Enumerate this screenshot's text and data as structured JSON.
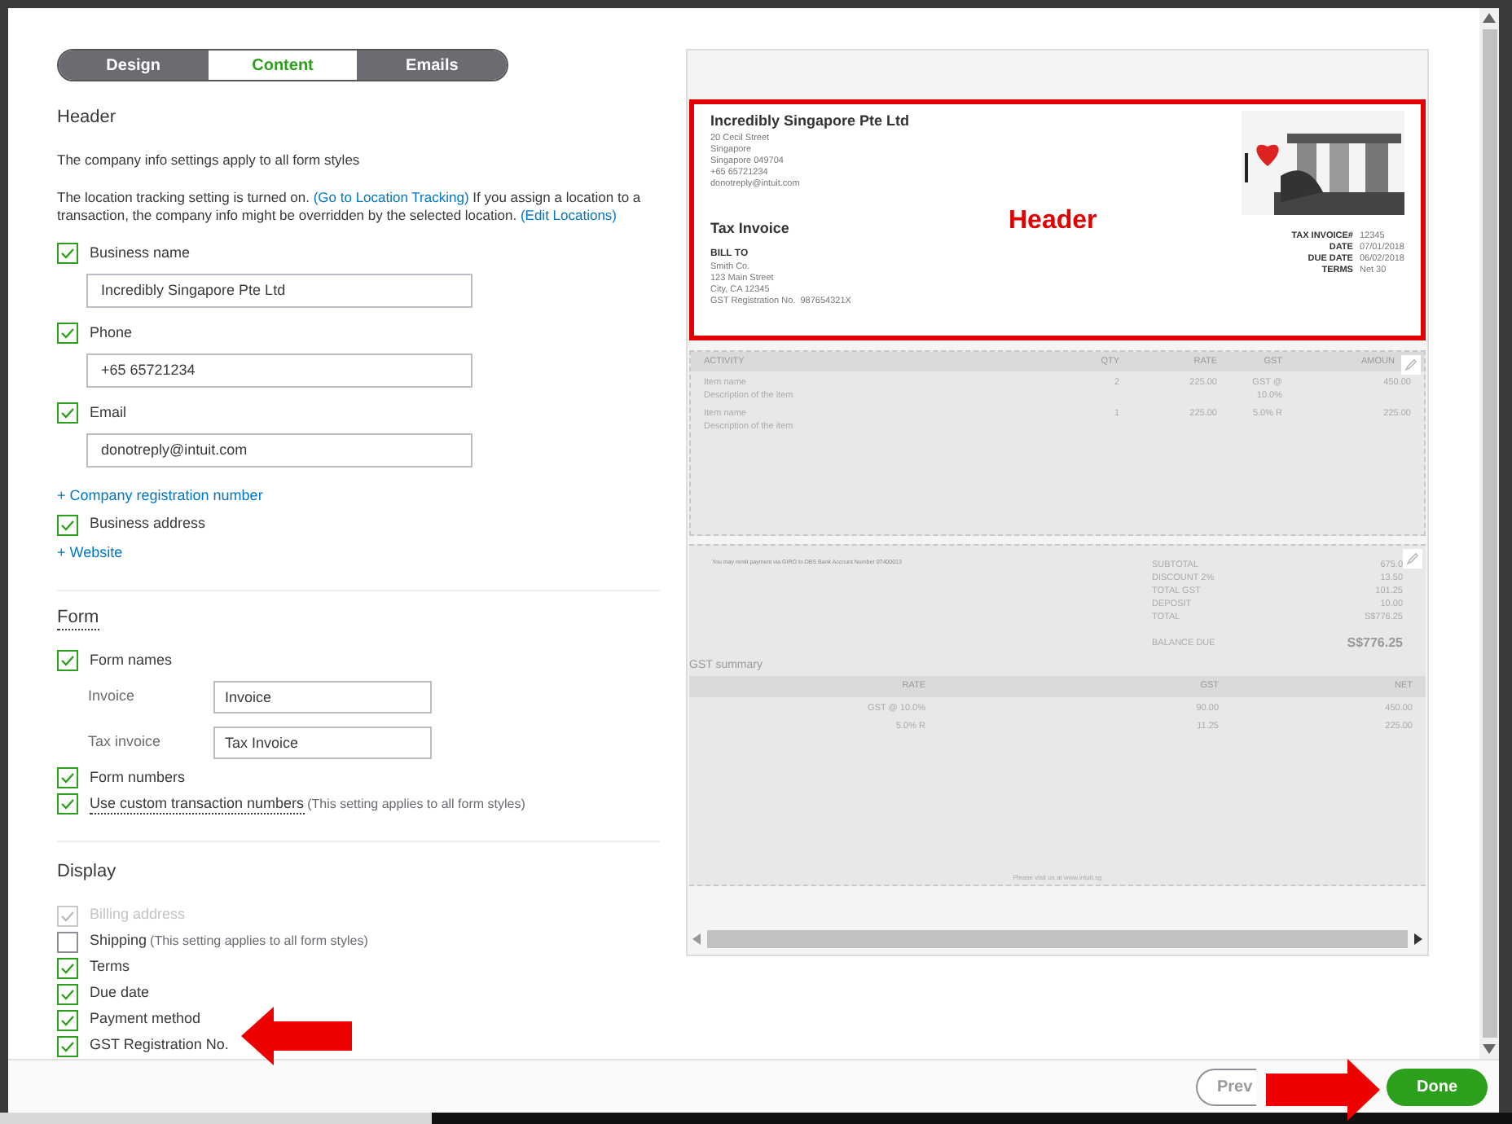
{
  "tabs": [
    {
      "label": "Design",
      "selected": false
    },
    {
      "label": "Content",
      "selected": true
    },
    {
      "label": "Emails",
      "selected": false
    }
  ],
  "sections": [
    {
      "title": "Header",
      "underlined": false,
      "rows": [
        {
          "kind": "text",
          "text": "The company info settings apply to all form styles"
        },
        {
          "kind": "link_text",
          "parts": [
            {
              "text": "The location tracking setting is turned on. ",
              "link": false
            },
            {
              "text": "(Go to Location Tracking)",
              "link": true
            },
            {
              "text": " If you assign a location to a transaction, the company info might be overridden by the selected location. ",
              "link": false
            },
            {
              "text": "(Edit Locations)",
              "link": true
            }
          ]
        },
        {
          "kind": "checkbox_field",
          "label": "Business name",
          "checked": true,
          "value": "Incredibly Singapore Pte Ltd"
        },
        {
          "kind": "checkbox_field",
          "label": "Phone",
          "checked": true,
          "value": "+65 65721234"
        },
        {
          "kind": "checkbox_field",
          "label": "Email",
          "checked": true,
          "value": "donotreply@intuit.com"
        },
        {
          "kind": "link",
          "label": "+ Company registration number"
        },
        {
          "kind": "checkbox",
          "label": "Business address",
          "checked": true
        },
        {
          "kind": "link",
          "label": "+ Website"
        }
      ]
    },
    {
      "title": "Form",
      "underlined": true,
      "rows": [
        {
          "kind": "checkbox",
          "label": "Form names",
          "checked": true
        },
        {
          "kind": "labeled_field",
          "label": "Invoice",
          "value": "Invoice"
        },
        {
          "kind": "labeled_field",
          "label": "Tax invoice",
          "value": "Tax Invoice"
        },
        {
          "kind": "checkbox",
          "label": "Form numbers",
          "checked": true
        },
        {
          "kind": "checkbox",
          "label": "Use custom transaction numbers",
          "note": "(This setting applies to all form styles)",
          "checked": true
        }
      ]
    },
    {
      "title": "Display",
      "underlined": false,
      "rows": [
        {
          "kind": "checkbox",
          "label": "Billing address",
          "checked": true,
          "disabled": true
        },
        {
          "kind": "checkbox",
          "label": "Shipping",
          "note": "(This setting applies to all form styles)",
          "checked": false,
          "disabled": false
        },
        {
          "kind": "checkbox",
          "label": "Terms",
          "checked": true,
          "disabled": false
        },
        {
          "kind": "checkbox",
          "label": "Due date",
          "checked": true,
          "disabled": false
        },
        {
          "kind": "checkbox",
          "label": "Payment method",
          "checked": true,
          "disabled": false
        },
        {
          "kind": "checkbox",
          "label": "GST Registration No.",
          "checked": true,
          "disabled": false
        }
      ]
    }
  ],
  "preview": {
    "company": "Incredibly Singapore Pte Ltd",
    "address": [
      "20 Cecil Street",
      "Singapore",
      "Singapore 049704",
      "+65 65721234",
      "donotreply@intuit.com"
    ],
    "logo": {
      "kind": "picture"
    },
    "doc_title": "Tax Invoice",
    "bill_to_label": "BILL TO",
    "bill_to": [
      "Smith Co.",
      "123 Main Street",
      "City, CA 12345",
      "GST Registration No.  987654321X"
    ],
    "meta": [
      {
        "label": "TAX INVOICE#",
        "value": "12345"
      },
      {
        "label": "DATE",
        "value": "07/01/2018"
      },
      {
        "label": "DUE DATE",
        "value": "06/02/2018"
      },
      {
        "label": "TERMS",
        "value": "Net 30"
      }
    ],
    "columns": [
      "ACTIVITY",
      "QTY",
      "RATE",
      "GST",
      "AMOUN"
    ],
    "items": [
      {
        "name": "Item name",
        "description": "Description of the item",
        "qty": "2",
        "rate": "225.00",
        "gst": "GST @ 10.0%",
        "amount": "450.00"
      },
      {
        "name": "Item name",
        "description": "Description of the item",
        "qty": "1",
        "rate": "225.00",
        "gst": "5.0% R",
        "amount": "225.00"
      }
    ],
    "message": "You may remit payment via GIRO to DBS Bank Account Number 07400013",
    "totals": [
      {
        "label": "SUBTOTAL",
        "value": "675.0"
      },
      {
        "label": "DISCOUNT 2%",
        "value": "13.50"
      },
      {
        "label": "TOTAL GST",
        "value": "101.25"
      },
      {
        "label": "DEPOSIT",
        "value": "10.00"
      },
      {
        "label": "TOTAL",
        "value": "S$776.25"
      }
    ],
    "balance_label": "BALANCE DUE",
    "balance": "S$776.25",
    "gst_title": "GST summary",
    "gst_columns": [
      "RATE",
      "GST",
      "NET"
    ],
    "gst_rows": [
      [
        "GST @ 10.0%",
        "90.00",
        "450.00"
      ],
      [
        "5.0% R",
        "11.25",
        "225.00"
      ]
    ],
    "footer": "Please visit us at www.intuit.sg"
  },
  "annotation": {
    "label": "Header"
  },
  "buttons": [
    {
      "label": "Prev",
      "kind": "secondary"
    },
    {
      "label": "Done",
      "kind": "primary"
    }
  ]
}
